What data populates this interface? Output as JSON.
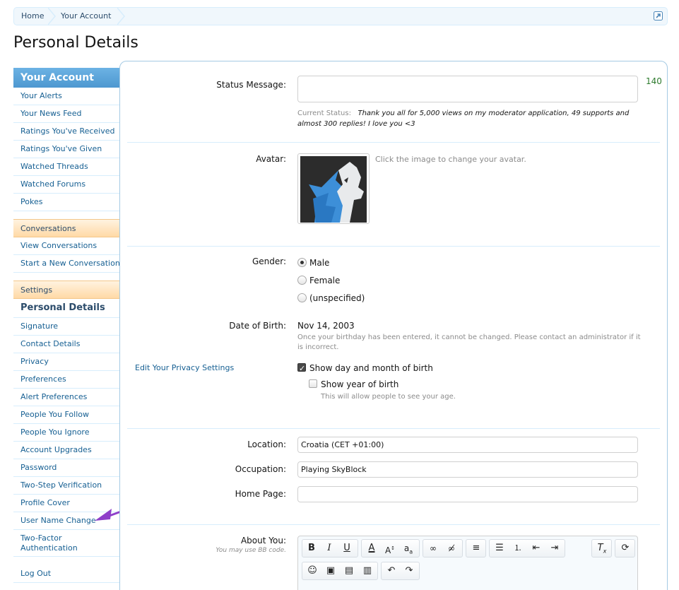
{
  "breadcrumb": {
    "home": "Home",
    "current": "Your Account"
  },
  "page": {
    "title": "Personal Details"
  },
  "sidebar": {
    "header": "Your Account",
    "account_items": [
      "Your Alerts",
      "Your News Feed",
      "Ratings You've Received",
      "Ratings You've Given",
      "Watched Threads",
      "Watched Forums",
      "Pokes"
    ],
    "conversations_header": "Conversations",
    "conversation_items": [
      "View Conversations",
      "Start a New Conversation"
    ],
    "settings_header": "Settings",
    "settings_active": "Personal Details",
    "settings_items": [
      "Signature",
      "Contact Details",
      "Privacy",
      "Preferences",
      "Alert Preferences",
      "People You Follow",
      "People You Ignore",
      "Account Upgrades",
      "Password",
      "Two-Step Verification",
      "Profile Cover",
      "User Name Change",
      "Two-Factor Authentication"
    ],
    "logout": "Log Out"
  },
  "status": {
    "label": "Status Message:",
    "value": "",
    "counter": "140",
    "current_label": "Current Status:",
    "current_text": "Thank you all for 5,000 views on my moderator application, 49 supports and almost 300 replies! I love you <3"
  },
  "avatar": {
    "label": "Avatar:",
    "hint": "Click the image to change your avatar."
  },
  "gender": {
    "label": "Gender:",
    "options": [
      "Male",
      "Female",
      "(unspecified)"
    ],
    "selected": "Male"
  },
  "dob": {
    "label": "Date of Birth:",
    "value": "Nov 14, 2003",
    "note": "Once your birthday has been entered, it cannot be changed. Please contact an administrator if it is incorrect.",
    "privacy_link": "Edit Your Privacy Settings",
    "show_day_month": "Show day and month of birth",
    "show_year": "Show year of birth",
    "year_hint": "This will allow people to see your age."
  },
  "location": {
    "label": "Location:",
    "value": "Croatia (CET +01:00)"
  },
  "occupation": {
    "label": "Occupation:",
    "value": "Playing SkyBlock"
  },
  "homepage": {
    "label": "Home Page:",
    "value": ""
  },
  "about": {
    "label": "About You:",
    "hint": "You may use BB code."
  },
  "colors": {
    "accent": "#176093",
    "arrow": "#8e3fc9"
  }
}
